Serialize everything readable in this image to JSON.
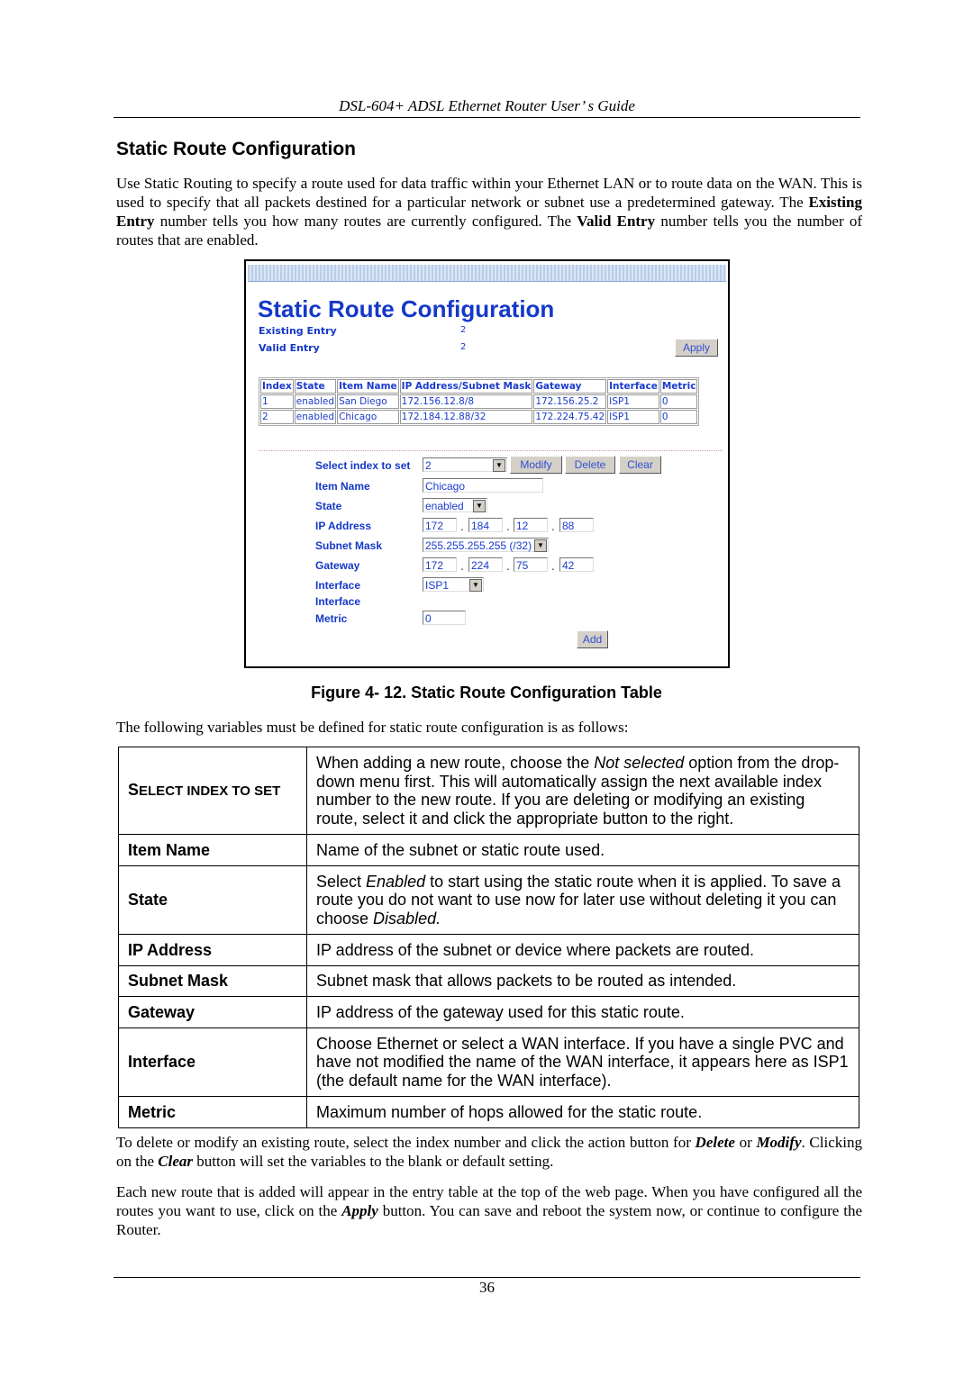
{
  "header": "DSL-604+ ADSL Ethernet Router User’ s Guide",
  "section_title": "Static Route Configuration",
  "intro": {
    "p1": "Use Static Routing to specify a route used for data traffic within your Ethernet LAN or to route data on the WAN. This is used to specify that all packets destined for a particular network or subnet use a predetermined gateway. The ",
    "b1": "Existing Entry",
    "p2": " number tells you how many routes are currently configured. The ",
    "b2": "Valid Entry",
    "p3": " number tells you the number of routes that are enabled."
  },
  "screenshot": {
    "title": "Static Route Configuration",
    "existing_label": "Existing Entry",
    "existing_value": "2",
    "valid_label": "Valid Entry",
    "valid_value": "2",
    "apply": "Apply",
    "columns": [
      "Index",
      "State",
      "Item Name",
      "IP Address/Subnet Mask",
      "Gateway",
      "Interface",
      "Metric"
    ],
    "rows": [
      [
        "1",
        "enabled",
        "San Diego",
        "172.156.12.8/8",
        "172.156.25.2",
        "ISP1",
        "0"
      ],
      [
        "2",
        "enabled",
        "Chicago",
        "172.184.12.88/32",
        "172.224.75.42",
        "ISP1",
        "0"
      ]
    ],
    "form": {
      "select_index_label": "Select index to set",
      "select_index_value": "2",
      "modify": "Modify",
      "delete": "Delete",
      "clear": "Clear",
      "item_name_label": "Item Name",
      "item_name_value": "Chicago",
      "state_label": "State",
      "state_value": "enabled",
      "ip_label": "IP Address",
      "ip": [
        "172",
        "184",
        "12",
        "88"
      ],
      "mask_label": "Subnet Mask",
      "mask_value": "255.255.255.255 (/32)",
      "gateway_label": "Gateway",
      "gateway": [
        "172",
        "224",
        "75",
        "42"
      ],
      "interface_label": "Interface",
      "interface_value": "ISP1",
      "interface_label2": "Interface",
      "metric_label": "Metric",
      "metric_value": "0",
      "add": "Add"
    }
  },
  "caption": "Figure 4- 12. Static Route Configuration Table",
  "variables_intro": "The following variables must be defined for static route configuration is as follows:",
  "variables": [
    {
      "key_a": "S",
      "key_b": "ELECT INDEX TO SET",
      "d1": "When adding a new route, choose the ",
      "i1": "Not selected",
      "d2": " option from the drop-down menu first. This will automatically assign the next available index number to the new route. If you are deleting or modifying an existing route, select it and click the appropriate button to the right."
    },
    {
      "key": "Item Name",
      "desc": "Name of the subnet or static route used."
    },
    {
      "key": "State",
      "d1": "Select ",
      "i1": "Enabled",
      "d2": " to start using the static route when it is applied. To save a route you do not want to use now for later use without deleting it you can choose ",
      "i2": "Disabled."
    },
    {
      "key": "IP Address",
      "desc": "IP address of the subnet or device where packets are routed."
    },
    {
      "key": "Subnet Mask",
      "desc": "Subnet mask that allows packets to be routed as intended."
    },
    {
      "key": "Gateway",
      "desc": "IP address of the gateway used for this static route."
    },
    {
      "key": "Interface",
      "desc": "Choose Ethernet or select a WAN interface. If you have a single PVC and have not modified the name of the WAN interface, it appears here as ISP1 (the default name for the WAN interface)."
    },
    {
      "key": "Metric",
      "desc": "Maximum number of hops allowed for the static route."
    }
  ],
  "outro1": {
    "a": "To delete or modify an existing route, select the index number and click the action button for ",
    "b": "Delete",
    "c": " or ",
    "d": "Modify",
    "e": ". Clicking on the ",
    "f": "Clear",
    "g": " button will set the variables to the blank or default setting."
  },
  "outro2": {
    "a": "Each new route that is added will appear in the entry table at the top of the web page. When you have configured all the routes you want to use, click on the ",
    "b": "Apply",
    "c": " button. You can save and reboot the system now, or continue to configure the Router."
  },
  "page_number": "36"
}
